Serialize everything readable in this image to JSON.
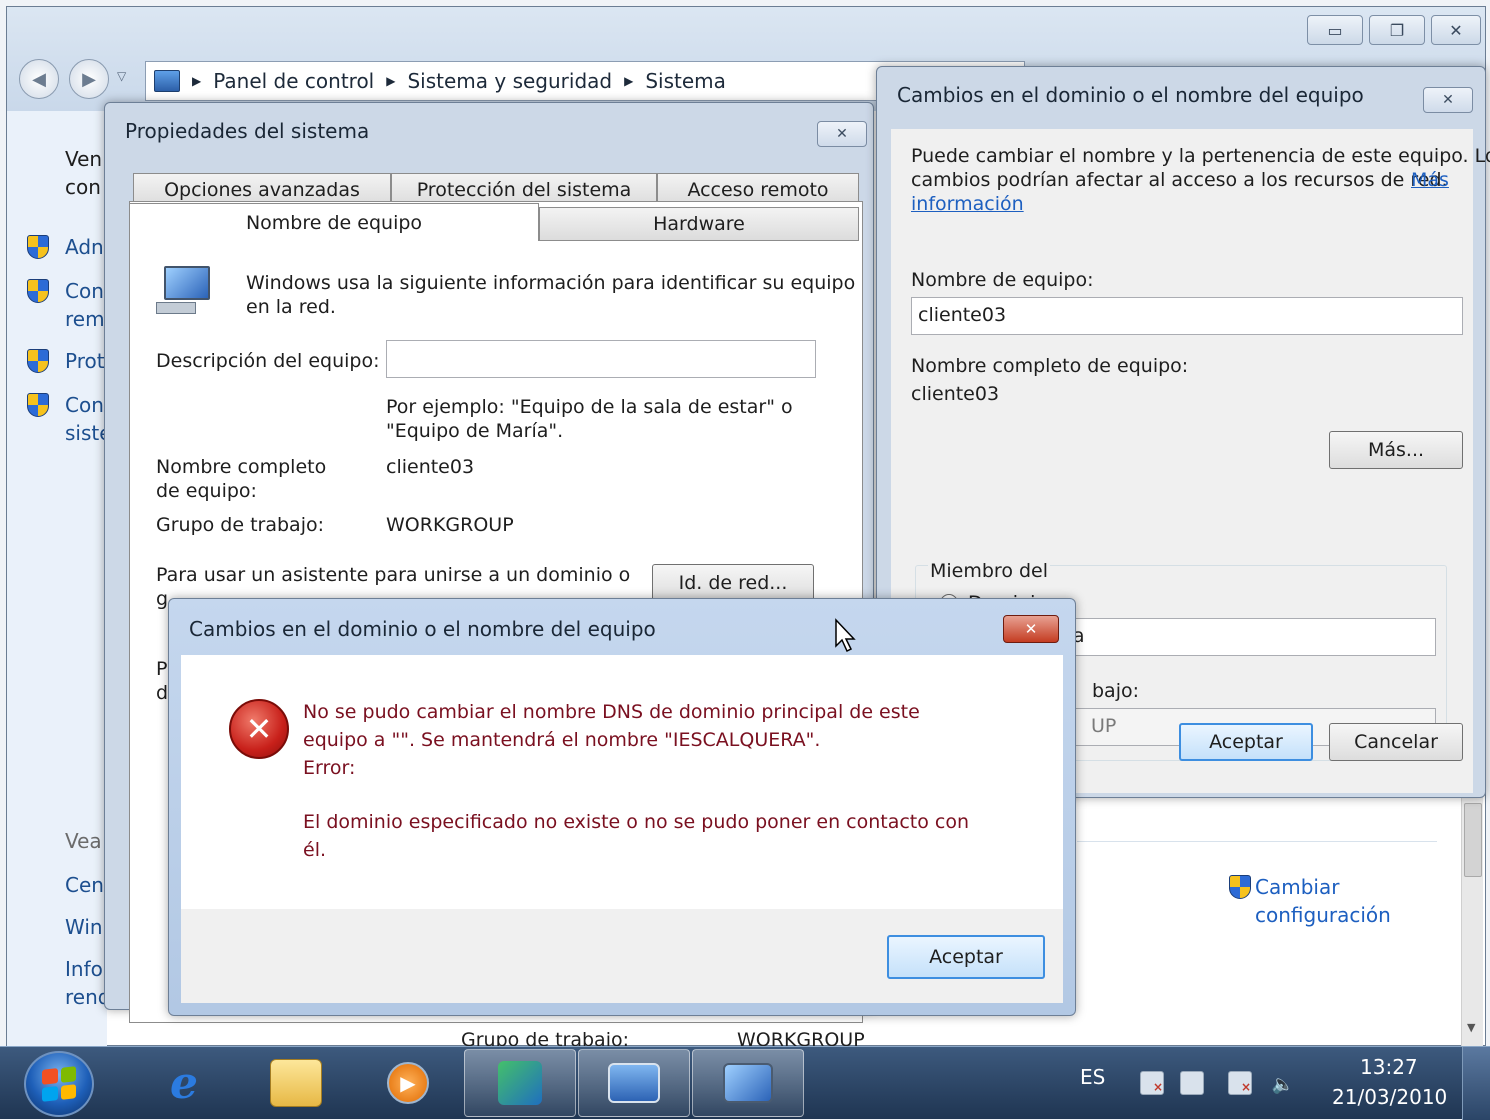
{
  "explorer": {
    "breadcrumb": [
      "Panel de control",
      "Sistema y seguridad",
      "Sistema"
    ],
    "left_pane": {
      "header_fragments": [
        "Ven",
        "con"
      ],
      "tasks": [
        {
          "lines": [
            "Adn"
          ]
        },
        {
          "lines": [
            "Con",
            "rem"
          ]
        },
        {
          "lines": [
            "Prot"
          ]
        },
        {
          "lines": [
            "Con",
            "siste"
          ]
        }
      ],
      "see_also_title": "Vea",
      "see_also": [
        "Cen",
        "Win",
        "Info",
        "rend"
      ]
    },
    "main_bottom": {
      "workgroup_label": "Grupo de trabajo:",
      "workgroup_value": "WORKGROUP",
      "change_settings_line1": "Cambiar",
      "change_settings_line2": "configuración"
    }
  },
  "sysprops": {
    "title": "Propiedades del sistema",
    "tabs_row1": [
      "Opciones avanzadas",
      "Protección del sistema",
      "Acceso remoto"
    ],
    "tabs_row2": [
      "Nombre de equipo",
      "Hardware"
    ],
    "intro_line1": "Windows usa la siguiente información para identificar su equipo",
    "intro_line2": "en la red.",
    "description_label": "Descripción del equipo:",
    "description_value": "",
    "example_line1": "Por ejemplo: \"Equipo de la sala de estar\" o",
    "example_line2": "\"Equipo de María\".",
    "fullname_label_line1": "Nombre completo",
    "fullname_label_line2": "de equipo:",
    "fullname_value": "cliente03",
    "workgroup_label": "Grupo de trabajo:",
    "workgroup_value": "WORKGROUP",
    "wizard_text_line1": "Para usar un asistente para unirse a un dominio o",
    "wizard_text_frag": "g",
    "network_id_button": "Id. de red...",
    "rename_frag_line1": "P",
    "rename_frag_line2": "d"
  },
  "domain_dialog": {
    "title": "Cambios en el dominio o el nombre del equipo",
    "intro_line1": "Puede cambiar el nombre y la pertenencia de este equipo. Los",
    "intro_line2": "cambios podrían afectar al acceso a los recursos de red.",
    "more_info_link_1": "Más",
    "more_info_link_2": "información",
    "computer_name_label": "Nombre de equipo:",
    "computer_name_value": "cliente03",
    "full_name_label": "Nombre completo de equipo:",
    "full_name_value": "cliente03",
    "more_button": "Más...",
    "member_of_label": "Miembro del",
    "domain_label": "Dominio:",
    "domain_value": "iescalquera",
    "workgroup_label_frag": "bajo:",
    "workgroup_value_frag": "UP",
    "ok_button": "Aceptar",
    "cancel_button": "Cancelar"
  },
  "error_dialog": {
    "title": "Cambios en el dominio o el nombre del equipo",
    "message_line1": "No se pudo cambiar el nombre DNS de dominio principal de este",
    "message_line2": "equipo a \"\". Se mantendrá el nombre \"IESCALQUERA\".",
    "message_line3": "Error:",
    "detail_line1": "El dominio especificado no existe o no se pudo poner en contacto con",
    "detail_line2": "él.",
    "ok_button": "Aceptar"
  },
  "taskbar": {
    "language": "ES",
    "time": "13:27",
    "date": "21/03/2010"
  },
  "colors": {
    "error_text": "#7a1020",
    "link": "#1d5fc0",
    "taskbar": "#2b4567"
  }
}
